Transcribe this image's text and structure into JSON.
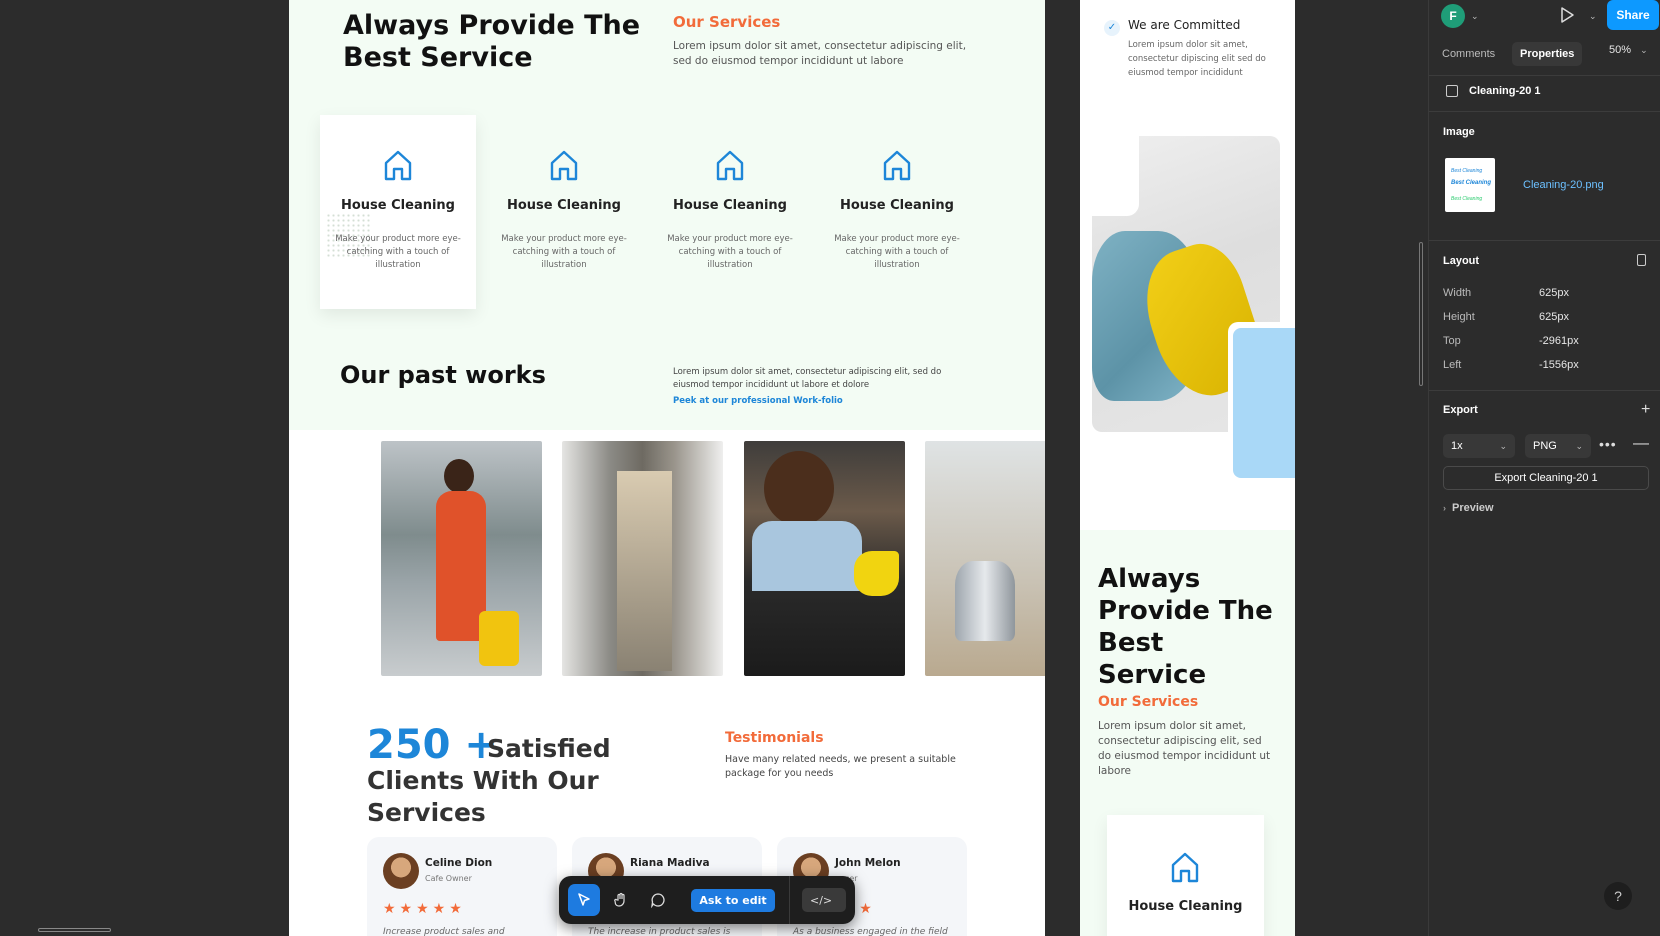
{
  "main": {
    "title": "Always Provide The Best Service",
    "services_heading": "Our Services",
    "services_desc": "Lorem ipsum dolor sit amet, consectetur adipiscing elit, sed do eiusmod tempor incididunt ut labore",
    "cards": [
      {
        "title": "House Cleaning",
        "desc": "Make your product more eye-catching with a touch of illustration"
      },
      {
        "title": "House Cleaning",
        "desc": "Make your product more eye-catching with a touch of illustration"
      },
      {
        "title": "House Cleaning",
        "desc": "Make your product more eye-catching with a touch of illustration"
      },
      {
        "title": "House Cleaning",
        "desc": "Make your product more eye-catching with a touch of illustration"
      }
    ],
    "past_title": "Our past works",
    "past_desc": "Lorem ipsum dolor sit amet, consectetur adipiscing elit, sed do eiusmod tempor incididunt ut labore et dolore",
    "past_link": "Peek at our professional Work-folio",
    "stat_number": "250 +",
    "stat_text": "Satisfied Clients With Our Services",
    "testimonials_heading": "Testimonials",
    "testimonials_desc": "Have many related needs, we present a suitable package for you needs",
    "testimonials": [
      {
        "name": "Celine Dion",
        "role": "Cafe Owner",
        "stars": "★★★★★",
        "quote": "Increase product sales and"
      },
      {
        "name": "Riana Madiva",
        "role": "",
        "stars": "★★★★★",
        "quote": "The increase in product sales is"
      },
      {
        "name": "John Melon",
        "role": "ancer",
        "stars": "★★★★★",
        "quote": "As a business engaged in the field"
      }
    ]
  },
  "toolbar": {
    "move_icon": "cursor-icon",
    "hand_icon": "hand-icon",
    "comment_icon": "comment-icon",
    "ask_label": "Ask to edit",
    "code_label": "</>"
  },
  "side": {
    "committed_title": "We are Committed",
    "committed_desc": "Lorem ipsum dolor sit amet, consectetur dipiscing elit sed do eiusmod tempor incididunt",
    "title": "Always Provide The Best Service",
    "services_heading": "Our Services",
    "services_desc": "Lorem ipsum dolor sit amet, consectetur adipiscing elit, sed do eiusmod tempor incididunt ut labore",
    "card_title": "House Cleaning"
  },
  "panel": {
    "avatar_initial": "F",
    "share_label": "Share",
    "tabs": [
      "Comments",
      "Properties"
    ],
    "zoom": "50%",
    "layer_name": "Cleaning-20 1",
    "image_section": "Image",
    "file_name": "Cleaning-20.png",
    "thumb_text": [
      "Best Cleaning",
      "Best Cleaning",
      "Best Cleaning"
    ],
    "layout_section": "Layout",
    "layout": [
      {
        "label": "Width",
        "value": "625px"
      },
      {
        "label": "Height",
        "value": "625px"
      },
      {
        "label": "Top",
        "value": "-2961px"
      },
      {
        "label": "Left",
        "value": "-1556px"
      }
    ],
    "export_section": "Export",
    "export_scale": "1x",
    "export_format": "PNG",
    "export_button": "Export Cleaning-20 1",
    "preview_label": "Preview",
    "help": "?"
  },
  "colors": {
    "accent_blue": "#1d86d8",
    "accent_orange": "#f26b3a",
    "share_blue": "#0d99ff",
    "mint_bg": "#f3fcf4"
  }
}
